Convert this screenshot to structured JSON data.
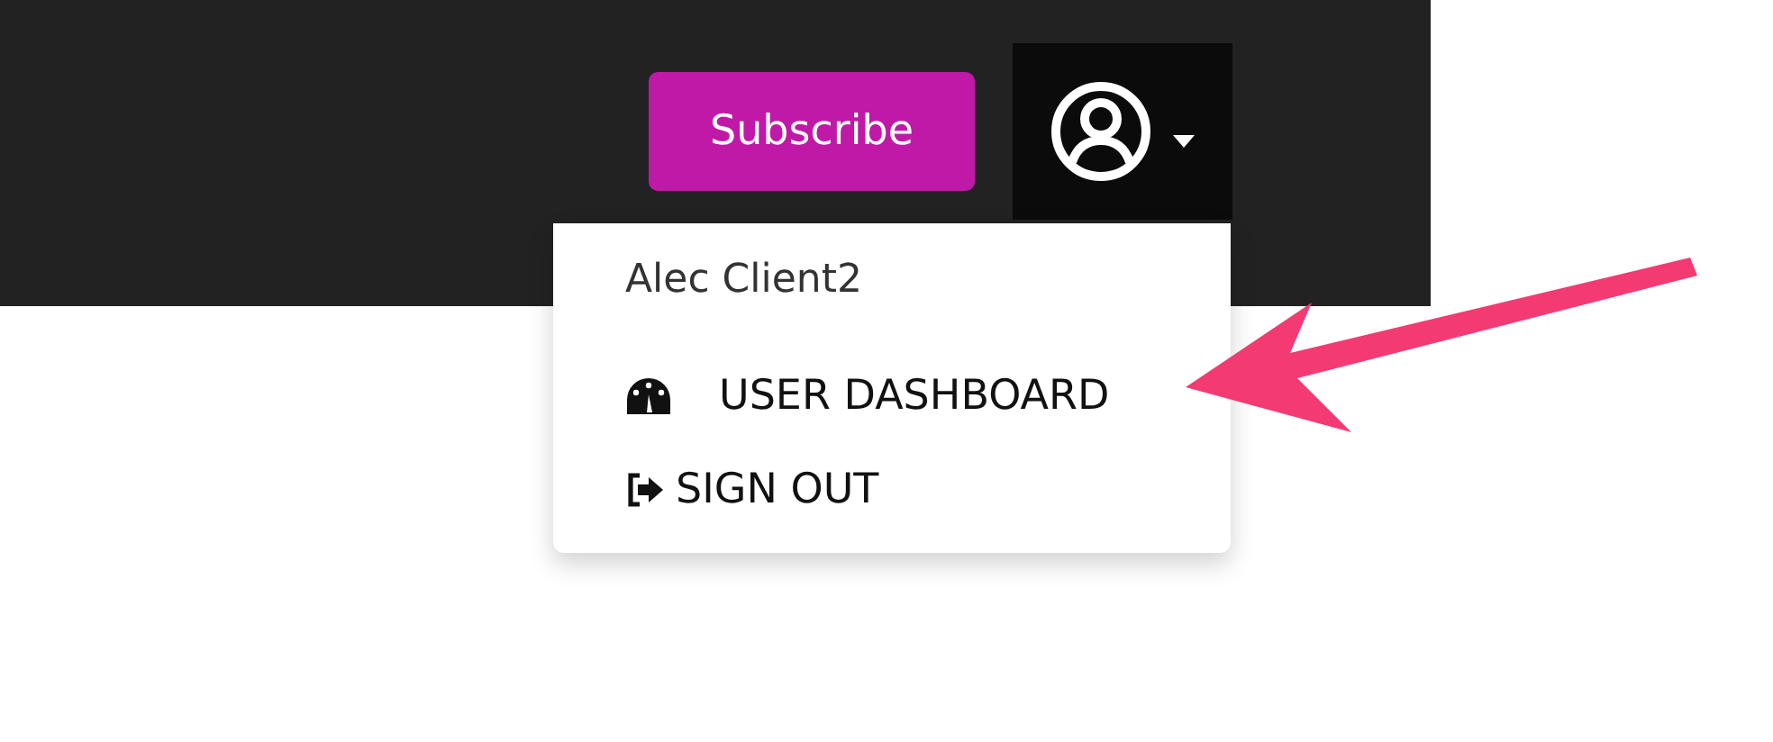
{
  "header": {
    "subscribe_button": {
      "label": "Subscribe"
    }
  },
  "user_menu": {
    "expanded": true,
    "name": "Alec Client2",
    "items": [
      {
        "kind": "dashboard",
        "label": "USER DASHBOARD"
      },
      {
        "kind": "sign_out",
        "label": "SIGN OUT"
      }
    ]
  }
}
